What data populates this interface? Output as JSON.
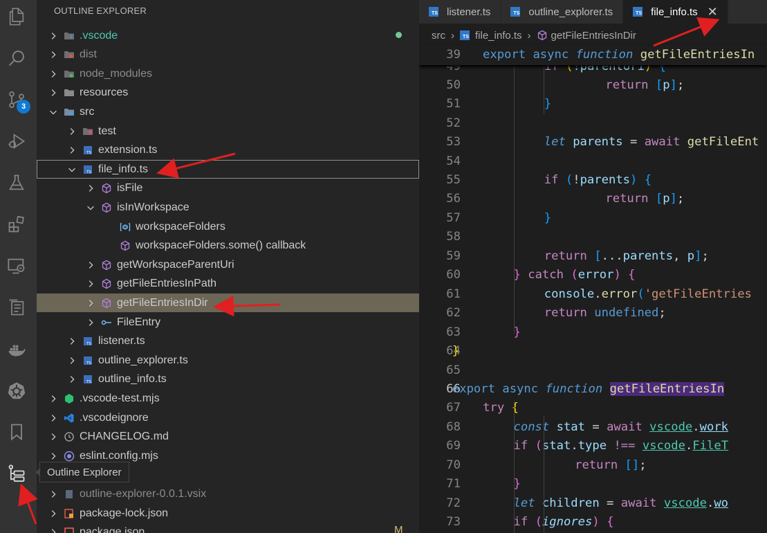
{
  "explorer": {
    "title": "OUTLINE EXPLORER",
    "rows": [
      {
        "label": ".vscode",
        "chevron": "right",
        "icon": "vscode-folder-icon",
        "depth": 0,
        "color": "teal",
        "dot": true
      },
      {
        "label": "dist",
        "chevron": "right",
        "icon": "dist-folder-icon",
        "depth": 0,
        "color": "dim"
      },
      {
        "label": "node_modules",
        "chevron": "right",
        "icon": "node-modules-folder-icon",
        "depth": 0,
        "color": "dim"
      },
      {
        "label": "resources",
        "chevron": "right",
        "icon": "folder-icon",
        "depth": 0
      },
      {
        "label": "src",
        "chevron": "down",
        "icon": "src-folder-icon",
        "depth": 0
      },
      {
        "label": "test",
        "chevron": "right",
        "icon": "test-folder-icon",
        "depth": 1
      },
      {
        "label": "extension.ts",
        "chevron": "right",
        "icon": "typescript-file-icon",
        "depth": 1
      },
      {
        "label": "file_info.ts",
        "chevron": "down",
        "icon": "typescript-file-icon",
        "depth": 1,
        "focused": true
      },
      {
        "label": "isFile",
        "chevron": "right",
        "icon": "function-icon",
        "depth": 2
      },
      {
        "label": "isInWorkspace",
        "chevron": "down",
        "icon": "function-icon",
        "depth": 2
      },
      {
        "label": "workspaceFolders",
        "chevron": "none",
        "icon": "variable-icon",
        "depth": 3
      },
      {
        "label": "workspaceFolders.some() callback",
        "chevron": "none",
        "icon": "function-icon",
        "depth": 3
      },
      {
        "label": "getWorkspaceParentUri",
        "chevron": "right",
        "icon": "function-icon",
        "depth": 2
      },
      {
        "label": "getFileEntriesInPath",
        "chevron": "right",
        "icon": "function-icon",
        "depth": 2
      },
      {
        "label": "getFileEntriesInDir",
        "chevron": "right",
        "icon": "function-icon",
        "depth": 2,
        "selected": true
      },
      {
        "label": "FileEntry",
        "chevron": "right",
        "icon": "interface-icon",
        "depth": 2
      },
      {
        "label": "listener.ts",
        "chevron": "right",
        "icon": "typescript-file-icon",
        "depth": 1
      },
      {
        "label": "outline_explorer.ts",
        "chevron": "right",
        "icon": "typescript-file-icon",
        "depth": 1
      },
      {
        "label": "outline_info.ts",
        "chevron": "right",
        "icon": "typescript-file-icon",
        "depth": 1
      },
      {
        "label": ".vscode-test.mjs",
        "chevron": "right",
        "icon": "mjs-file-icon",
        "depth": 0
      },
      {
        "label": ".vscodeignore",
        "chevron": "right",
        "icon": "vscode-file-icon",
        "depth": 0
      },
      {
        "label": "CHANGELOG.md",
        "chevron": "right",
        "icon": "markdown-file-icon",
        "depth": 0
      },
      {
        "label": "eslint.config.mjs",
        "chevron": "right",
        "icon": "eslint-file-icon",
        "depth": 0
      },
      {
        "label": "",
        "chevron": "none",
        "icon": "none",
        "depth": 0
      },
      {
        "label": "outline-explorer-0.0.1.vsix",
        "chevron": "right",
        "icon": "vsix-file-icon",
        "depth": 0,
        "color": "dim"
      },
      {
        "label": "package-lock.json",
        "chevron": "right",
        "icon": "package-lock-icon",
        "depth": 0
      },
      {
        "label": "package.json",
        "chevron": "right",
        "icon": "package-json-icon",
        "depth": 0
      }
    ],
    "modified_flag": "M"
  },
  "activity_bar": {
    "scm_badge": "3",
    "tooltip": "Outline Explorer"
  },
  "editor": {
    "tabs": [
      {
        "label": "listener.ts",
        "active": false
      },
      {
        "label": "outline_explorer.ts",
        "active": false
      },
      {
        "label": "file_info.ts",
        "active": true
      }
    ],
    "close_glyph": "✕",
    "breadcrumb": {
      "folder": "src",
      "file": "file_info.ts",
      "symbol": "getFileEntriesInDir"
    },
    "sticky_line": {
      "num": "39"
    },
    "line_numbers": [
      "50",
      "51",
      "52",
      "53",
      "54",
      "55",
      "56",
      "57",
      "58",
      "59",
      "60",
      "61",
      "62",
      "63",
      "64",
      "65",
      "66",
      "67",
      "68",
      "69",
      "70",
      "71",
      "72",
      "73"
    ],
    "partial_line_number": "49",
    "current_line": "66"
  },
  "colors": {
    "activity_bar": "#333333",
    "sidebar": "#252526",
    "editor": "#1e1e1e",
    "selection": "#6c6657",
    "badge": "#0e7ad3",
    "annotation_arrow": "#e02020"
  }
}
